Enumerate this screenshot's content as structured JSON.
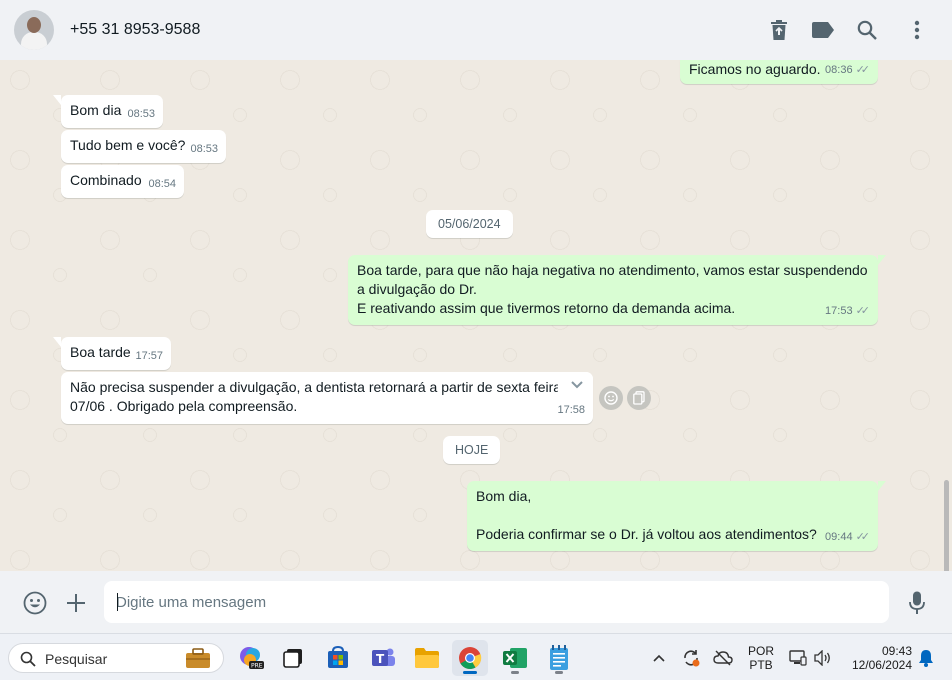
{
  "header": {
    "contact_name": "+55 31 8953-9588",
    "icons": [
      "delete-icon",
      "label-icon",
      "search-icon",
      "menu-icon"
    ]
  },
  "messages": {
    "m0": {
      "text": "Ficamos no aguardo.",
      "time": "08:36",
      "direction": "out"
    },
    "m1": {
      "text": "Bom dia",
      "time": "08:53",
      "direction": "in"
    },
    "m2": {
      "text": "Tudo bem e você?",
      "time": "08:53",
      "direction": "in"
    },
    "m3": {
      "text": "Combinado",
      "time": "08:54",
      "direction": "in"
    },
    "date1": "05/06/2024",
    "m4": {
      "line1": "Boa tarde, para que não haja negativa no atendimento, vamos estar suspendendo",
      "line2": "a divulgação do Dr.",
      "line3": "E reativando assim que tivermos retorno da demanda acima.",
      "time": "17:53",
      "direction": "out"
    },
    "m5": {
      "text": "Boa tarde",
      "time": "17:57",
      "direction": "in"
    },
    "m6": {
      "line1": "Não precisa suspender a divulgação, a dentista retornará a partir de sexta feira",
      "line2": "07/06 . Obrigado pela compreensão.",
      "time": "17:58",
      "direction": "in"
    },
    "date2": "HOJE",
    "m7": {
      "line1": "Bom dia,",
      "line2": "Poderia confirmar se o Dr. já voltou aos atendimentos?",
      "time": "09:44",
      "direction": "out"
    }
  },
  "composer": {
    "placeholder": "Digite uma mensagem"
  },
  "taskbar": {
    "search_label": "Pesquisar",
    "language": "POR",
    "keyboard": "PTB",
    "clock_time": "09:43",
    "clock_date": "12/06/2024"
  },
  "colors": {
    "outgoing_bubble": "#d9fdd3",
    "incoming_bubble": "#ffffff",
    "chat_background": "#efeae2",
    "header_background": "#f0f2f5"
  }
}
